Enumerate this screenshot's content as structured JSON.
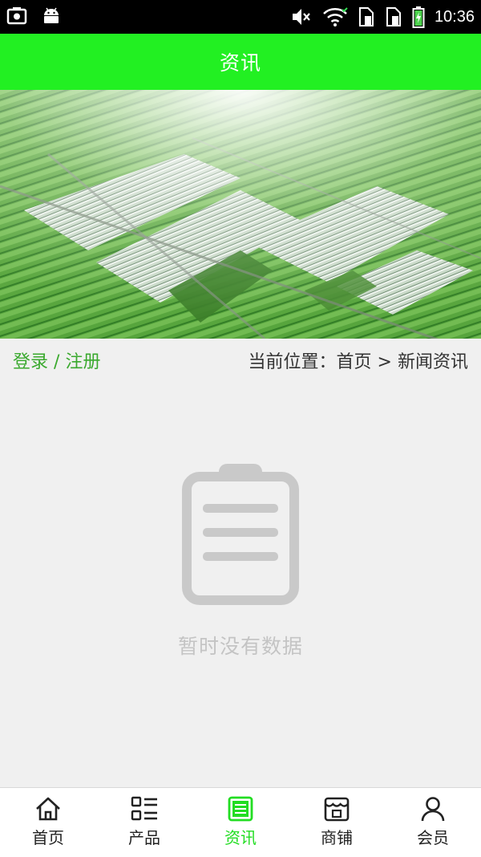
{
  "status_bar": {
    "time": "10:36",
    "icons": [
      "screenshot-icon",
      "android-icon",
      "mute-icon",
      "wifi-icon",
      "sim-1-icon",
      "sim-2-icon",
      "battery-icon"
    ]
  },
  "header": {
    "title": "资讯"
  },
  "banner": {
    "subject": "aerial-greenhouse-farmland"
  },
  "breadcrumb": {
    "login_label": "登录",
    "separator": "/",
    "register_label": "注册",
    "location_prefix": "当前位置：",
    "home_label": "首页",
    "arrow": ">",
    "current_label": "新闻资讯"
  },
  "empty_state": {
    "icon": "clipboard-icon",
    "message": "暂时没有数据"
  },
  "bottom_nav": {
    "active": "资讯",
    "active_color": "#22dd22",
    "items": [
      {
        "label": "首页",
        "icon": "home-icon"
      },
      {
        "label": "产品",
        "icon": "list-grid-icon"
      },
      {
        "label": "资讯",
        "icon": "news-icon"
      },
      {
        "label": "商铺",
        "icon": "store-icon"
      },
      {
        "label": "会员",
        "icon": "user-icon"
      }
    ]
  },
  "colors": {
    "accent": "#22f022",
    "status_bar": "#000000",
    "link_green": "#3aa92e"
  }
}
